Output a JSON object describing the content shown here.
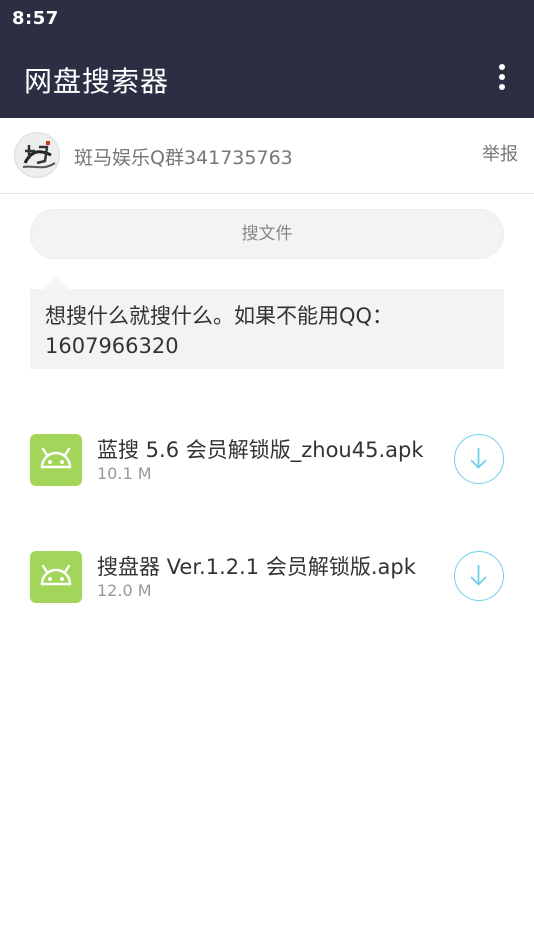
{
  "status_bar": {
    "time": "8:57"
  },
  "app_bar": {
    "title": "网盘搜索器"
  },
  "group": {
    "name": "斑马娱乐Q群341735763",
    "report_label": "举报"
  },
  "search": {
    "label": "搜文件"
  },
  "message": {
    "text": "想搜什么就搜什么。如果不能用QQ：1607966320"
  },
  "files": [
    {
      "name": "蓝搜 5.6 会员解锁版_zhou45.apk",
      "size": "10.1 M"
    },
    {
      "name": "搜盘器 Ver.1.2.1 会员解锁版.apk",
      "size": "12.0 M"
    }
  ],
  "colors": {
    "app_bar": "#2c2e44",
    "apk_icon": "#a4d55b",
    "download_accent": "#6fd0ea"
  }
}
